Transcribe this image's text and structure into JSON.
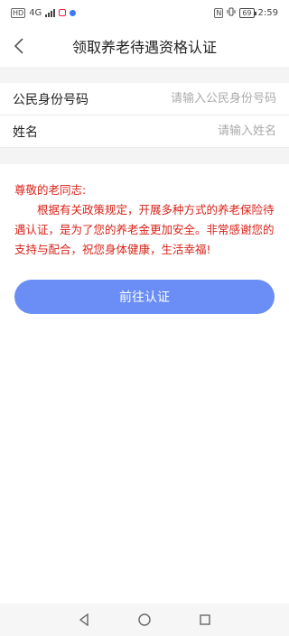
{
  "status_bar": {
    "left_chip": "HD",
    "network": "4G",
    "nfc_chip": "N",
    "battery": "69",
    "time": "2:59"
  },
  "header": {
    "title": "领取养老待遇资格认证",
    "back_icon": "chevron-left-icon"
  },
  "form": {
    "id_label": "公民身份号码",
    "id_placeholder": "请输入公民身份号码",
    "name_label": "姓名",
    "name_placeholder": "请输入姓名"
  },
  "notice": {
    "greeting": "尊敬的老同志:",
    "body": "根据有关政策规定，开展多种方式的养老保险待遇认证，是为了您的养老金更加安全。非常感谢您的支持与配合，祝您身体健康，生活幸福!",
    "color": "#d9231a"
  },
  "actions": {
    "submit_label": "前往认证",
    "accent": "#6a8ef5"
  },
  "nav": {
    "back": "triangle-back-icon",
    "home": "circle-home-icon",
    "recent": "square-recent-icon"
  }
}
